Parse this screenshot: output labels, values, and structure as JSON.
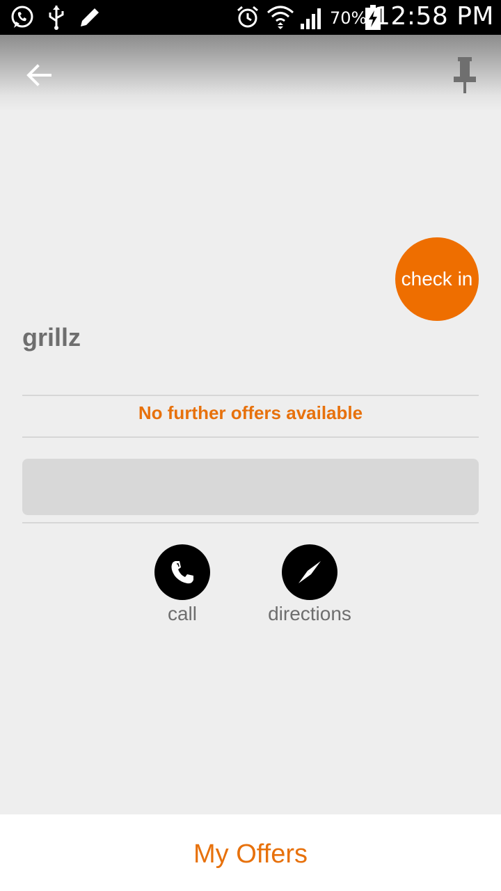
{
  "status_bar": {
    "battery_percent": "70%",
    "time": "12:58 PM",
    "icons": [
      "whatsapp-icon",
      "usb-icon",
      "pencil-icon",
      "alarm-icon",
      "wifi-icon",
      "signal-icon",
      "battery-charging-icon"
    ]
  },
  "toolbar": {
    "back_icon": "arrow-back-icon",
    "pin_icon": "pin-icon"
  },
  "checkin": {
    "label": "check in",
    "color": "#ee6e00"
  },
  "venue": {
    "name": "grillz"
  },
  "offers": {
    "status": "No further offers available",
    "color": "#e7710c"
  },
  "actions": {
    "call": {
      "label": "call",
      "icon": "phone-icon"
    },
    "directions": {
      "label": "directions",
      "icon": "compass-icon"
    }
  },
  "bottom": {
    "my_offers": "My Offers"
  }
}
